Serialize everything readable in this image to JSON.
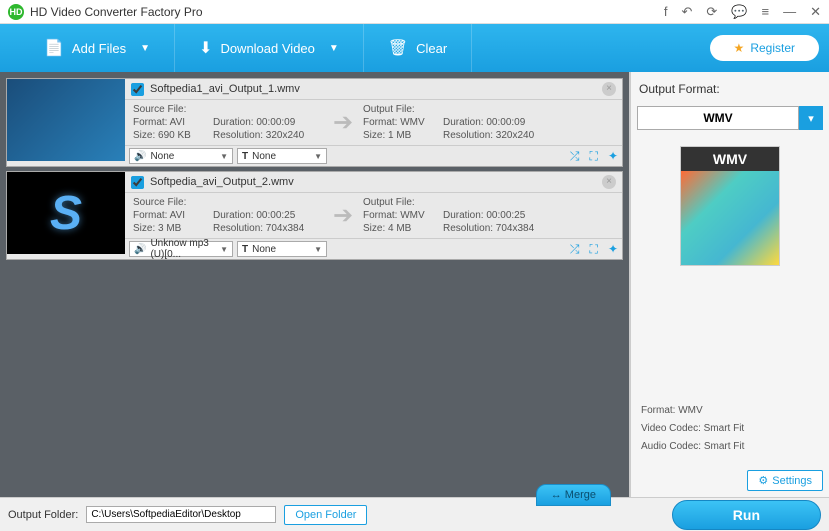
{
  "titlebar": {
    "logo": "HD",
    "title": "HD Video Converter Factory Pro"
  },
  "toolbar": {
    "add_files": "Add Files",
    "download_video": "Download Video",
    "clear": "Clear",
    "register": "Register"
  },
  "files": [
    {
      "name": "Softpedia1_avi_Output_1.wmv",
      "checked": true,
      "source": {
        "label": "Source File:",
        "format": "Format: AVI",
        "size": "Size: 690 KB",
        "duration": "Duration: 00:00:09",
        "resolution": "Resolution: 320x240"
      },
      "output": {
        "label": "Output File:",
        "format": "Format: WMV",
        "size": "Size: 1 MB",
        "duration": "Duration: 00:00:09",
        "resolution": "Resolution: 320x240"
      },
      "audio": "None",
      "text": "None"
    },
    {
      "name": "Softpedia_avi_Output_2.wmv",
      "checked": true,
      "source": {
        "label": "Source File:",
        "format": "Format: AVI",
        "size": "Size: 3 MB",
        "duration": "Duration: 00:00:25",
        "resolution": "Resolution: 704x384"
      },
      "output": {
        "label": "Output File:",
        "format": "Format: WMV",
        "size": "Size: 4 MB",
        "duration": "Duration: 00:00:25",
        "resolution": "Resolution: 704x384"
      },
      "audio": "Unknow mp3 (U)[0...",
      "text": "None"
    }
  ],
  "side": {
    "heading": "Output Format:",
    "format": "WMV",
    "badge": "WMV",
    "meta_format": "Format: WMV",
    "meta_video": "Video Codec: Smart Fit",
    "meta_audio": "Audio Codec: Smart Fit",
    "settings": "Settings"
  },
  "bottom": {
    "label": "Output Folder:",
    "path": "C:\\Users\\SoftpediaEditor\\Desktop",
    "open_folder": "Open Folder",
    "merge": "↔ Merge",
    "run": "Run"
  }
}
